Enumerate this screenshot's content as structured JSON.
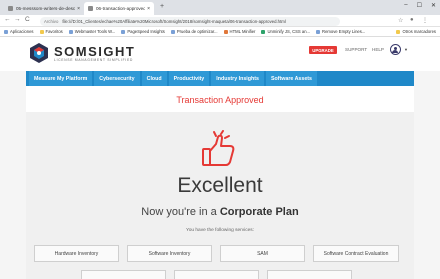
{
  "browser": {
    "tabs": [
      {
        "title": "05-messsom-writers-de-descargo/..."
      },
      {
        "title": "06-transaction-approved.html"
      }
    ],
    "new_tab": "+",
    "back": "←",
    "forward": "→",
    "reload": "C",
    "url_label": "Archivo",
    "url": "file:///D:/01_Clientes/echae%20Affiliate%20Microsoft/Somsight/2018/somsight-maqueta/06-transaction-approved.html",
    "bookmarks": [
      "Aplicaciones",
      "Favoritos",
      "Webmaster Tools W...",
      "PageSpeed Insights",
      "Prueba de optimizar...",
      "HTML Minifier",
      "Unminify JS, CSS an...",
      "Remove Empty Lines..."
    ],
    "other_bookmarks": "Otros marcadores"
  },
  "header": {
    "logo_name": "SOMSIGHT",
    "logo_tagline": "LICENSE MANAGEMENT SIMPLIFIED",
    "upgrade": "UPGRADE",
    "support": "SUPPORT",
    "help": "HELP"
  },
  "nav": [
    "Measure My Platform",
    "Cybersecurity",
    "Cloud",
    "Productivity",
    "Industry Insights",
    "Software Assets"
  ],
  "content": {
    "title": "Transaction Approved",
    "headline": "Excellent",
    "plan_prefix": "Now you're in a ",
    "plan_name": "Corporate Plan",
    "services_label": "You have the following services:",
    "services": [
      "Hardware Inventory",
      "Software Inventory",
      "SAM",
      "Software Contract Evaluation"
    ]
  },
  "colors": {
    "accent": "#e53935",
    "nav": "#1f88c8"
  }
}
